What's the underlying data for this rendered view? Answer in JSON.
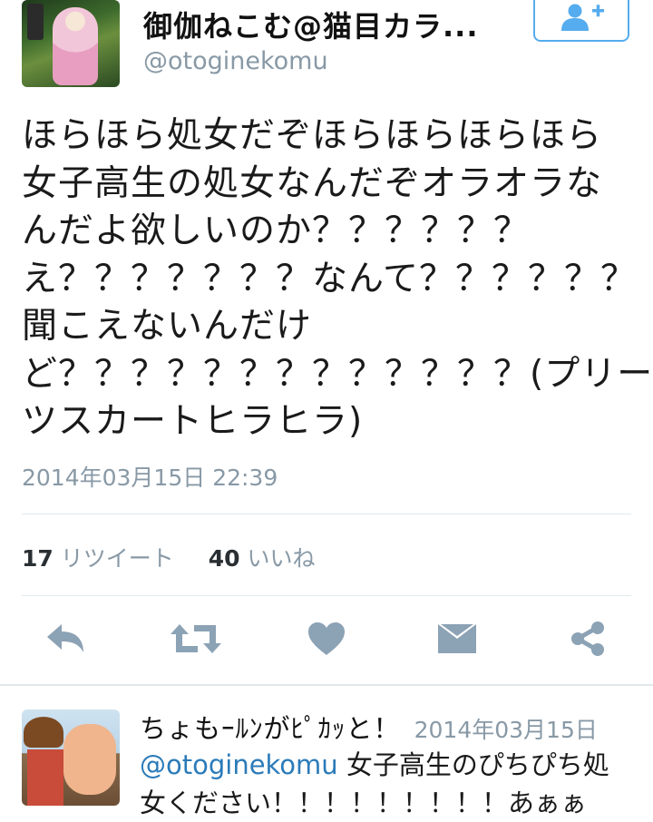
{
  "tweet": {
    "display_name": "御伽ねこむ@猫目カラ...",
    "handle": "@otoginekomu",
    "text_lines": [
      "ほらほら処女だぞほらほらほらほら",
      "女子高生の処女なんだぞオラオラな",
      "んだよ欲しいのか？？？？？？",
      "え？？？？？？？なんて？？？？？？",
      "聞こえないんだけ",
      "ど？？？？？？？？？？？？？(プリー",
      "ツスカートヒラヒラ)"
    ],
    "timestamp": "2014年03月15日 22:39",
    "retweet_count": "17",
    "retweet_label": "リツイート",
    "like_count": "40",
    "like_label": "いいね"
  },
  "icons": {
    "follow": "follow-user-plus-icon",
    "reply": "reply-arrow-icon",
    "retweet": "retweet-icon",
    "like": "heart-icon",
    "dm": "envelope-icon",
    "share": "share-icon"
  },
  "colors": {
    "accent": "#55acee",
    "action_icon": "#8ca2b5",
    "muted_text": "#8899a6",
    "link": "#2b7bb9"
  },
  "reply": {
    "display_name": "ちょもｰﾙﾝがﾋﾟｶｯと！",
    "time": "2014年03月15日",
    "mention": "@otoginekomu",
    "text_line1": "女子高生のぴちぴち処",
    "text_line2": "女ください！！！！！！！！！あぁぁ"
  }
}
